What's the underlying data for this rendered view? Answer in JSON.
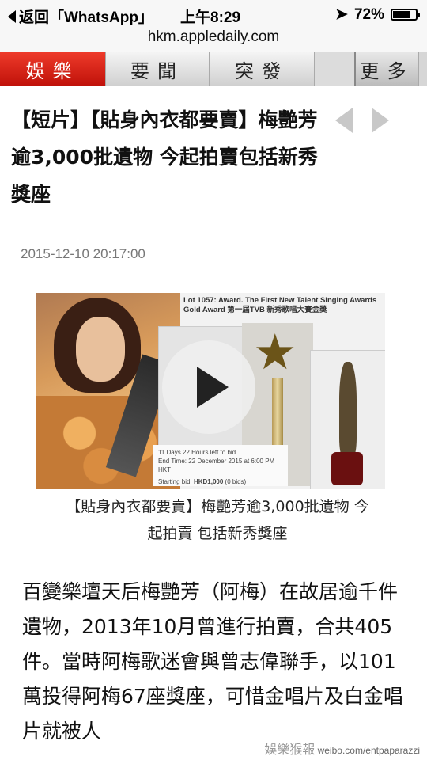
{
  "status": {
    "back_label": "返回「WhatsApp」",
    "time": "上午8:29",
    "battery": "72%",
    "battery_level": 0.72
  },
  "url": "hkm.appledaily.com",
  "nav": {
    "tabs": [
      {
        "label": "娛樂",
        "active": true
      },
      {
        "label": "要聞",
        "active": false
      },
      {
        "label": "突發",
        "active": false
      }
    ],
    "more_label": "更多"
  },
  "article": {
    "headline": "【短片】【貼身內衣都要賣】梅艷芳逾3,000批遺物 今起拍賣包括新秀獎座",
    "date": "2015-12-10 20:17:00",
    "video": {
      "lot_text": "Lot 1057: Award. The First New Talent Singing Awards Gold Award 第一屆TVB 新秀歌唱大賽金獎",
      "time_left": "11 Days 22 Hours left to bid",
      "end_time": "End Time: 22 December 2015 at 6:00 PM HKT",
      "starting_bid_label": "Starting bid:",
      "starting_bid_value": "HKD1,000",
      "bids": "(0 bids)"
    },
    "caption": "【貼身內衣都要賣】梅艷芳逾3,000批遺物 今起拍賣 包括新秀獎座",
    "body": "百變樂壇天后梅艷芳（阿梅）在故居逾千件遺物，2013年10月曾進行拍賣，合共405件。當時阿梅歌迷會與曾志偉聯手，以101萬投得阿梅67座獎座，可惜金唱片及白金唱片就被人"
  },
  "watermark": {
    "logo_text": "娛樂猴報",
    "url": "weibo.com/entpaparazzi"
  },
  "colors": {
    "nav_active": "#d9251a",
    "date_text": "#777777"
  }
}
